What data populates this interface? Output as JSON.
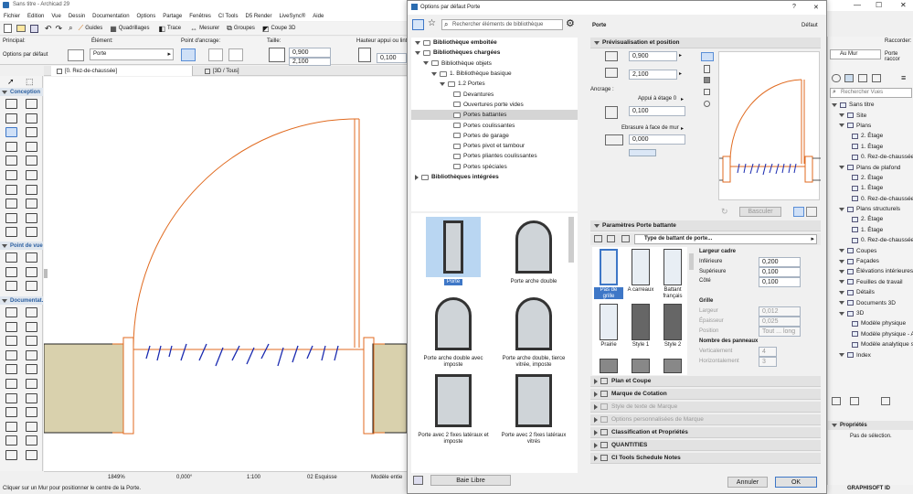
{
  "app": {
    "title": "Sans titre - Archicad 29",
    "menu": [
      "Fichier",
      "Edition",
      "Vue",
      "Dessin",
      "Documentation",
      "Options",
      "Partage",
      "Fenêtres",
      "CI Tools",
      "D5 Render",
      "LiveSync®",
      "Aide"
    ]
  },
  "toolbar": {
    "guides": "Guides",
    "quadrillages": "Quadrillages",
    "trace": "Trace",
    "mesurer": "Mesurer",
    "groupes": "Groupes",
    "coupe3d": "Coupe 3D"
  },
  "info_box": {
    "principal": "Principal:",
    "options_defaut": "Options par défaut",
    "element_label": "Élément:",
    "element_value": "Porte",
    "point_ancrage": "Point d'ancrage:",
    "taille": "Taille:",
    "width": "0,900",
    "height": "2,100",
    "hauteur_appui": "Hauteur appui ou linteau:",
    "appui_value": "0,100"
  },
  "tabs": {
    "plan": "[0. Rez-de-chaussée]",
    "threed": "[3D / Tous]"
  },
  "toolbox": {
    "conception": "Conception",
    "point_de_vue": "Point de vue",
    "documentation": "Documentat."
  },
  "status": {
    "zoom": "1849%",
    "angle": "0,000°",
    "scale": "1:100",
    "esquisse": "02 Esquisse",
    "modele": "Modèle entie",
    "hint": "Cliquer sur un Mur pour positionner le centre de la Porte."
  },
  "dialog": {
    "title": "Options par défaut Porte",
    "help": "?",
    "close": "✕",
    "search_placeholder": "Rechercher éléments de bibliothèque",
    "tree": [
      {
        "label": "Bibliothèque emboîtée",
        "level": 0,
        "bold": true
      },
      {
        "label": "Bibliothèques chargées",
        "level": 0,
        "bold": true
      },
      {
        "label": "Bibliothèque objets",
        "level": 1
      },
      {
        "label": "1. Bibliothèque basique",
        "level": 2
      },
      {
        "label": "1.2 Portes",
        "level": 3
      },
      {
        "label": "Devantures",
        "level": 4
      },
      {
        "label": "Ouvertures porte vides",
        "level": 4
      },
      {
        "label": "Portes battantes",
        "level": 4,
        "selected": true
      },
      {
        "label": "Portes coulissantes",
        "level": 4
      },
      {
        "label": "Portes de garage",
        "level": 4
      },
      {
        "label": "Portes pivot et tambour",
        "level": 4
      },
      {
        "label": "Portes pliantes coulissantes",
        "level": 4
      },
      {
        "label": "Portes spéciales",
        "level": 4
      },
      {
        "label": "Bibliothèques intégrées",
        "level": 0,
        "bold": true
      }
    ],
    "gallery": [
      "Porte",
      "Porte arche double",
      "Porte arche double avec imposte",
      "Porte arche double, tierce vitrée, imposte",
      "Porte avec 2 fixes latéraux et imposte",
      "Porte avec 2 fixes latéraux vitrés"
    ],
    "baie_libre": "Baie Libre",
    "right_title": "Porte",
    "right_default": "Défaut",
    "preview_header": "Prévisualisation et position",
    "width": "0,900",
    "height": "2,100",
    "ancrage": "Ancrage :",
    "appui_etage": "Appui à étage 0",
    "appui_value": "0,100",
    "ebrasure": "Ebrasure à face de mur",
    "ebrasure_value": "0,000",
    "basculer": "Basculer",
    "params_header": "Paramètres Porte battante",
    "type_battant": "Type de battant de porte...",
    "styles": [
      {
        "label": "Pas de grille",
        "selected": true
      },
      {
        "label": "A carreaux"
      },
      {
        "label": "Battant français"
      },
      {
        "label": "Prairie"
      },
      {
        "label": "Style 1"
      },
      {
        "label": "Style 2"
      }
    ],
    "largeur_cadre": "Largeur cadre",
    "inferieure": "Inférieure",
    "inferieure_val": "0,200",
    "superieure": "Supérieure",
    "superieure_val": "0,100",
    "cote": "Côté",
    "cote_val": "0,100",
    "grille": "Grille",
    "largeur": "Largeur",
    "largeur_val": "0,012",
    "epaisseur": "Épaisseur",
    "epaisseur_val": "0,025",
    "position": "Position",
    "position_val": "Tout ... long",
    "nombre_panneaux": "Nombre des panneaux",
    "verticalement": "Verticalement",
    "verticalement_val": "4",
    "horizontalement": "Horizontalement",
    "horizontalement_val": "3",
    "sections": [
      {
        "label": "Plan et Coupe",
        "disabled": false
      },
      {
        "label": "Marque de Cotation",
        "disabled": false
      },
      {
        "label": "Style de texte de Marque",
        "disabled": true
      },
      {
        "label": "Options personnalisées de Marque",
        "disabled": true
      },
      {
        "label": "Classification et Propriétés",
        "disabled": false
      },
      {
        "label": "QUANTITIES",
        "disabled": false
      },
      {
        "label": "CI Tools Schedule Notes",
        "disabled": false
      }
    ],
    "cancel": "Annuler",
    "ok": "OK"
  },
  "right_panel": {
    "raccorder": "Raccorder:",
    "au_mur": "Au Mur",
    "porte_racc": "Porte raccor",
    "search_placeholder": "Rechercher Vues",
    "views": [
      {
        "label": "Sans titre",
        "level": 0
      },
      {
        "label": "Site",
        "level": 1
      },
      {
        "label": "Plans",
        "level": 1
      },
      {
        "label": "2. Étage",
        "level": 2
      },
      {
        "label": "1. Étage",
        "level": 2
      },
      {
        "label": "0. Rez-de-chaussée",
        "level": 2
      },
      {
        "label": "Plans de plafond",
        "level": 1
      },
      {
        "label": "2. Étage",
        "level": 2
      },
      {
        "label": "1. Étage",
        "level": 2
      },
      {
        "label": "0. Rez-de-chaussée",
        "level": 2
      },
      {
        "label": "Plans structurels",
        "level": 1
      },
      {
        "label": "2. Étage",
        "level": 2
      },
      {
        "label": "1. Étage",
        "level": 2
      },
      {
        "label": "0. Rez-de-chaussée",
        "level": 2
      },
      {
        "label": "Coupes",
        "level": 1
      },
      {
        "label": "Façades",
        "level": 1
      },
      {
        "label": "Élévations intérieures",
        "level": 1
      },
      {
        "label": "Feuilles de travail",
        "level": 1
      },
      {
        "label": "Détails",
        "level": 1
      },
      {
        "label": "Documents 3D",
        "level": 1
      },
      {
        "label": "3D",
        "level": 1
      },
      {
        "label": "Modèle physique",
        "level": 2
      },
      {
        "label": "Modèle physique - Axo",
        "level": 2
      },
      {
        "label": "Modèle analytique stru",
        "level": 2
      },
      {
        "label": "Index",
        "level": 1
      }
    ],
    "proprietes": "Propriétés",
    "pas_selection": "Pas de sélection.",
    "graphisoft": "GRAPHISOFT ID"
  }
}
